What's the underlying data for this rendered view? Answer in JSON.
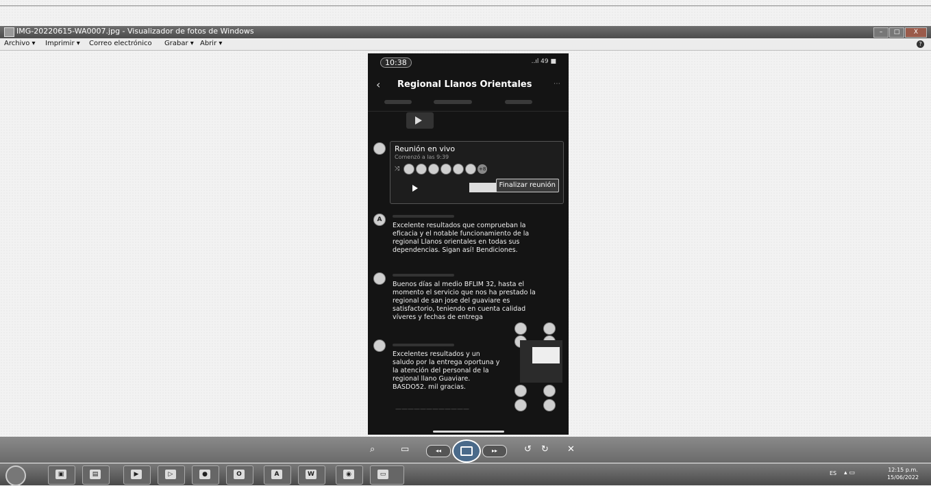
{
  "window": {
    "title": "IMG-20220615-WA0007.jpg - Visualizador de fotos de Windows",
    "min_icon": "minimize-icon",
    "max_icon": "maximize-icon",
    "close_glyph": "X"
  },
  "menu": {
    "items": [
      "Archivo ▾",
      "Imprimir ▾",
      "Correo electrónico",
      "Grabar ▾",
      "Abrir ▾"
    ],
    "help_glyph": "?"
  },
  "phone": {
    "time": "10:38",
    "status": "..ıl 49 ■",
    "header": {
      "back_glyph": "‹",
      "title": "Regional Llanos Orientales",
      "chevron": "⌄"
    },
    "meeting": {
      "title": "Reunión en vivo",
      "subtitle": "Comenzó a las 9:39",
      "extra_count": "+8",
      "end_button": "Finalizar reunión"
    },
    "messages": [
      "Excelente resultados que comprueban la eficacia y el notable funcionamiento de la regional Llanos orientales en todas sus dependencias. Sigan así! Bendiciones.",
      "Buenos días al medio BFLIM 32, hasta el momento el servicio que nos ha prestado la regional de san jose del guaviare es satisfactorio, teniendo en cuenta calidad víveres y fechas de entrega",
      "Excelentes resultados y un saludo por la entrega oportuna y la atención del personal de la regional llano Guaviare. BASDO52. mil gracias."
    ],
    "avatar_letter": "A"
  },
  "viewer_controls": {
    "zoom_glyph": "⌕",
    "prev_label": "◂◂",
    "next_label": "▸▸",
    "rotate_left": "↺",
    "rotate_right": "↻",
    "delete_glyph": "✕"
  },
  "taskbar": {
    "apps": [
      {
        "icon": "photo-viewer-icon",
        "glyph": "▣"
      },
      {
        "icon": "folder-icon",
        "glyph": "▤"
      },
      {
        "icon": "media-player-icon",
        "glyph": "▶"
      },
      {
        "icon": "video-icon",
        "glyph": "▷"
      },
      {
        "icon": "firefox-icon",
        "glyph": "●"
      },
      {
        "icon": "outlook-icon",
        "glyph": "O"
      },
      {
        "icon": "acrobat-icon",
        "glyph": "A"
      },
      {
        "icon": "word-icon",
        "glyph": "W"
      },
      {
        "icon": "chrome-icon",
        "glyph": "◉"
      },
      {
        "icon": "photo-viewer-active-icon",
        "glyph": "▭"
      }
    ],
    "lang": "ES",
    "clock_time": "12:15 p.m.",
    "clock_date": "15/06/2022"
  }
}
